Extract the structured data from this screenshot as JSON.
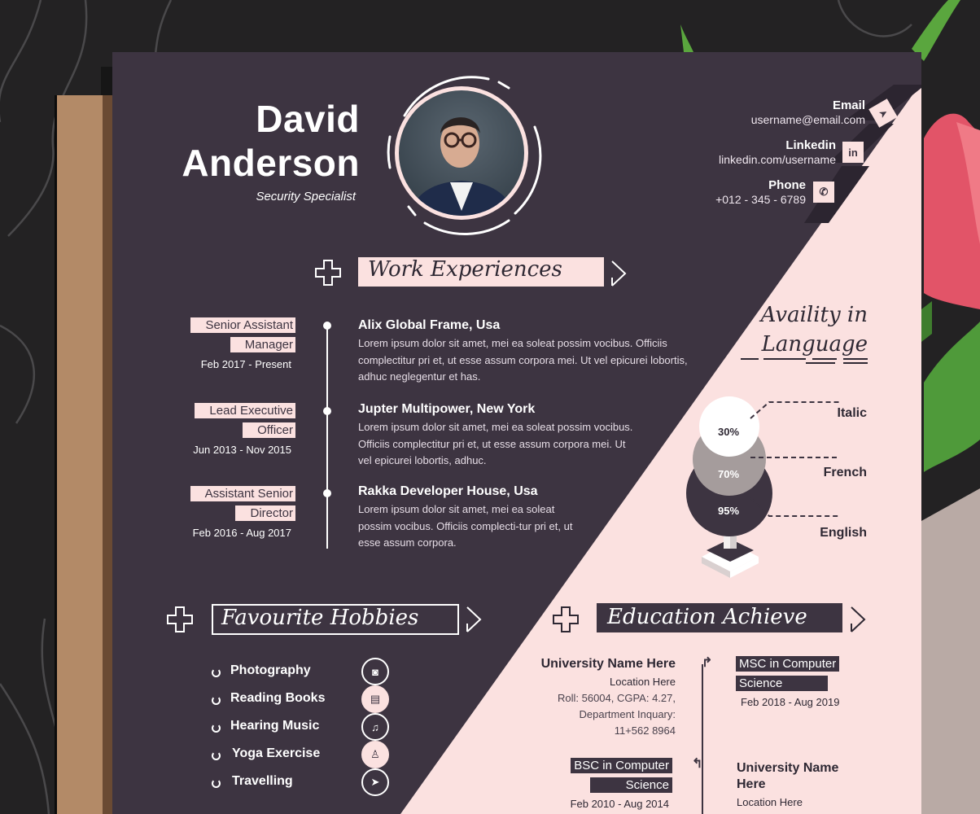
{
  "resume": {
    "name_first": "David",
    "name_last": "Anderson",
    "role": "Security Specialist",
    "contacts": [
      {
        "label": "Email",
        "value": "username@email.com",
        "icon": "paper-plane-icon",
        "glyph": "➤"
      },
      {
        "label": "Linkedin",
        "value": "linkedin.com/username",
        "icon": "linkedin-icon",
        "glyph": "in"
      },
      {
        "label": "Phone",
        "value": "+012 - 345 - 6789",
        "icon": "phone-icon",
        "glyph": "✆"
      }
    ],
    "work": {
      "title": "Work Experiences",
      "jobs": [
        {
          "title_line1": "Senior Assistant",
          "title_line2": "Manager",
          "date": "Feb 2017 - Present",
          "company": "Alix Global Frame, Usa",
          "desc": "Lorem ipsum dolor sit amet, mei ea soleat possim vocibus. Officiis complectitur pri et, ut esse assum corpora mei. Ut vel epicurei lobortis, adhuc neglegentur et has."
        },
        {
          "title_line1": "Lead Executive",
          "title_line2": "Officer",
          "date": "Jun 2013 - Nov 2015",
          "company": "Jupter Multipower, New York",
          "desc": "Lorem ipsum dolor sit amet, mei ea soleat possim vocibus. Officiis complectitur pri et, ut esse assum corpora mei. Ut vel epicurei lobortis, adhuc."
        },
        {
          "title_line1": "Assistant Senior",
          "title_line2": "Director",
          "date": "Feb 2016 - Aug 2017",
          "company": "Rakka Developer House, Usa",
          "desc": "Lorem ipsum dolor sit amet, mei ea soleat possim vocibus. Officiis complecti-tur pri et, ut esse assum corpora."
        }
      ]
    },
    "language": {
      "title_line1": "Availity in",
      "title_line2": "Language",
      "items": [
        {
          "name": "Italic",
          "percent": "30%",
          "level": 0.3,
          "color": "#ffffff",
          "text_color": "#2e2833"
        },
        {
          "name": "French",
          "percent": "70%",
          "level": 0.7,
          "color": "#a59c9c",
          "text_color": "#ffffff"
        },
        {
          "name": "English",
          "percent": "95%",
          "level": 0.95,
          "color": "#3d3441",
          "text_color": "#ffffff"
        }
      ]
    },
    "hobbies": {
      "title": "Favourite Hobbies",
      "items": [
        {
          "label": "Photography",
          "icon": "camera-icon",
          "glyph": "◙"
        },
        {
          "label": "Reading Books",
          "icon": "book-icon",
          "glyph": "▤"
        },
        {
          "label": "Hearing Music",
          "icon": "music-note-icon",
          "glyph": "♫"
        },
        {
          "label": "Yoga Exercise",
          "icon": "yoga-icon",
          "glyph": "♙"
        },
        {
          "label": "Travelling",
          "icon": "paper-plane-icon",
          "glyph": "➤"
        }
      ]
    },
    "education": {
      "title": "Education Achieve",
      "entry1": {
        "university": "University Name Here",
        "location": "Location Here",
        "details_line1": "Roll: 56004, CGPA: 4.27,",
        "details_line2": "Department Inquary:",
        "details_line3": "11+562 8964"
      },
      "degree1": {
        "line1": "MSC in Computer",
        "line2": "Science",
        "date": "Feb 2018 - Aug 2019"
      },
      "degree2": {
        "line1": "BSC in Computer",
        "line2": "Science",
        "date": "Feb 2010 - Aug 2014"
      },
      "entry2": {
        "university_line1": "University Name",
        "university_line2": "Here",
        "location": "Location Here"
      }
    },
    "colors": {
      "dark": "#3d3441",
      "pink": "#fbe1e0",
      "gray": "#a59c9c",
      "brown": "#b38a67"
    }
  }
}
